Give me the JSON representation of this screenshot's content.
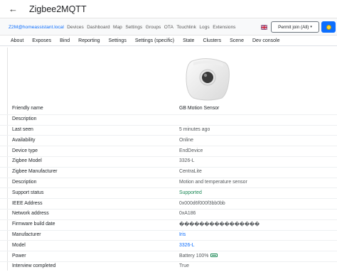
{
  "app": {
    "back_glyph": "←",
    "title": "Zigbee2MQTT"
  },
  "nav": {
    "brand": "Z2M@homeassistant.local",
    "links": [
      "Devices",
      "Dashboard",
      "Map",
      "Settings",
      "Groups",
      "OTA",
      "Touchlink",
      "Logs",
      "Extensions"
    ],
    "permit_label": "Permit join (All)",
    "permit_caret": "▾",
    "flag_icon": "uk-flag-icon",
    "status_icon": "sun-icon"
  },
  "tabs": [
    "About",
    "Exposes",
    "Bind",
    "Reporting",
    "Settings",
    "Settings (specific)",
    "State",
    "Clusters",
    "Scene",
    "Dev console"
  ],
  "device": {
    "image_icon": "motion-sensor-device-icon",
    "rows": [
      {
        "label": "Friendly name",
        "value": "GB Motion Sensor"
      },
      {
        "label": "Description",
        "value": ""
      },
      {
        "label": "Last seen",
        "value": "5 minutes ago"
      },
      {
        "label": "Availability",
        "value": "Online"
      },
      {
        "label": "Device type",
        "value": "EndDevice"
      },
      {
        "label": "Zigbee Model",
        "value": "3326-L"
      },
      {
        "label": "Zigbee Manufacturer",
        "value": "CentraLite"
      },
      {
        "label": "Description",
        "value": "Motion and temperature sensor"
      },
      {
        "label": "Support status",
        "value": "Supported"
      },
      {
        "label": "IEEE Address",
        "value": "0x000d6f000f3bb0bb"
      },
      {
        "label": "Network address",
        "value": "0xA186"
      },
      {
        "label": "Firmware build date",
        "value": "����������������"
      },
      {
        "label": "Manufacturer",
        "value": "Iris"
      },
      {
        "label": "Model",
        "value": "3326-L"
      },
      {
        "label": "Power",
        "value": "Battery 100%"
      },
      {
        "label": "Interview completed",
        "value": "True"
      }
    ],
    "battery_icon": "battery-full-icon"
  },
  "colors": {
    "accent": "#0d6efd",
    "supported": "#198754",
    "status_dot": "#ffd92f"
  }
}
